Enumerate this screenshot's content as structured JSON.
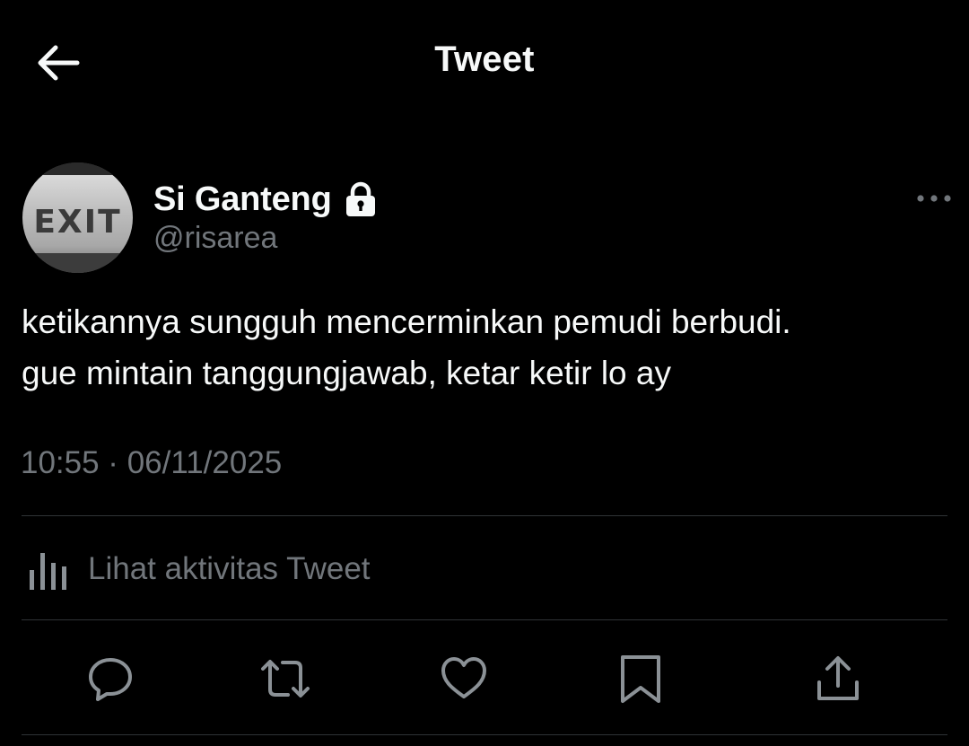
{
  "header": {
    "back_icon": "arrow-left-icon",
    "title": "Tweet"
  },
  "author": {
    "avatar_text": "EXIT",
    "display_name": "Si Ganteng",
    "protected_icon": "lock-icon",
    "handle": "@risarea",
    "more_icon": "more-horizontal-icon"
  },
  "tweet": {
    "lines": [
      "ketikannya sungguh mencerminkan pemudi berbudi.",
      "gue mintain tanggungjawab, ketar ketir lo ay"
    ],
    "timestamp": "10:55 · 06/11/2025"
  },
  "activity": {
    "icon": "bar-chart-icon",
    "label": "Lihat aktivitas Tweet"
  },
  "actions": [
    {
      "name": "reply",
      "icon": "reply-icon"
    },
    {
      "name": "retweet",
      "icon": "retweet-icon"
    },
    {
      "name": "like",
      "icon": "heart-icon"
    },
    {
      "name": "bookmark",
      "icon": "bookmark-icon"
    },
    {
      "name": "share",
      "icon": "share-icon"
    }
  ],
  "colors": {
    "background": "#000000",
    "text_primary": "#f7f9f9",
    "text_secondary": "#71767b",
    "divider": "#2f3336",
    "icon": "#8b9196"
  }
}
